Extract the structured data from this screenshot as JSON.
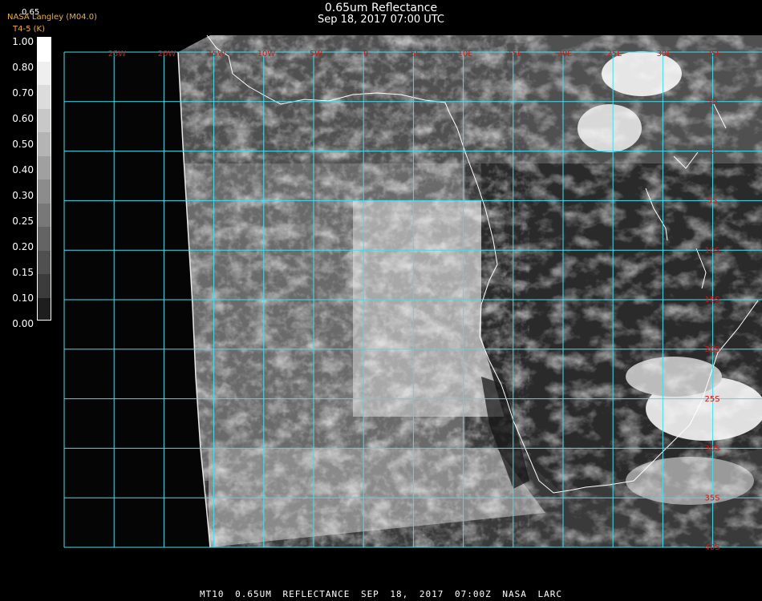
{
  "title": "0.65um Reflectance",
  "subtitle": "Sep 18, 2017 07:00 UTC",
  "credit": "NASA Langley (M04.0)",
  "credit_sub": "T4-5 (K)",
  "colorbar_top_value": "0.65",
  "colorbar": {
    "labels": [
      "1.00",
      "0.80",
      "0.70",
      "0.60",
      "0.50",
      "0.40",
      "0.30",
      "0.25",
      "0.20",
      "0.15",
      "0.10",
      "0.00"
    ],
    "colors": [
      "#ffffff",
      "#efefef",
      "#dcdcdc",
      "#c8c8c8",
      "#b4b4b4",
      "#a0a0a0",
      "#8c8c8c",
      "#787878",
      "#646464",
      "#505050",
      "#3c3c3c",
      "#1e1e1e"
    ]
  },
  "longitude_labels": [
    "25W",
    "20W",
    "15W",
    "10W",
    "5W",
    "0",
    "5E",
    "10E",
    "15E",
    "20E",
    "25E",
    "30E",
    "35E"
  ],
  "latitude_labels": [
    "5N",
    "0",
    "5S",
    "10S",
    "15S",
    "20S",
    "25S",
    "30S",
    "35S",
    "40S"
  ],
  "grid_color": "#40e0f0",
  "coast_color": "#ffffff",
  "label_color": "#d01818",
  "footer": "MT10  0.65UM REFLECTANCE   SEP 18, 2017 07:00Z   NASA LARC"
}
